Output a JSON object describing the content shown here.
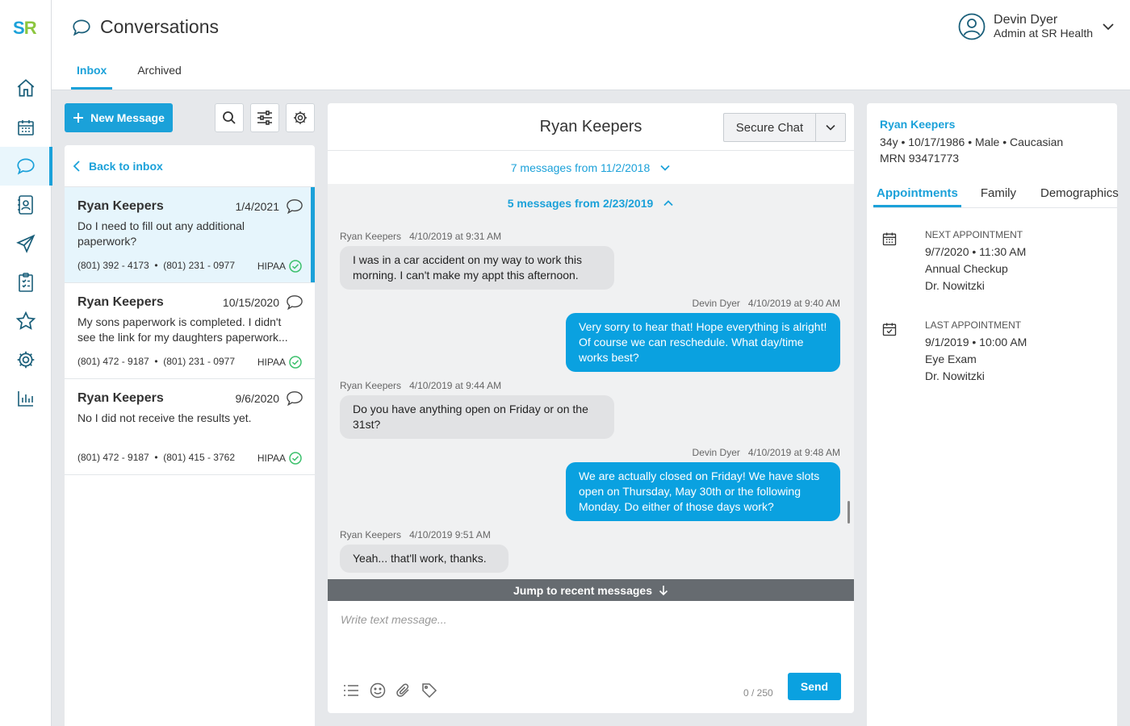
{
  "app": {
    "logo_s": "S",
    "logo_r": "R",
    "title": "Conversations",
    "tabs": [
      {
        "label": "Inbox",
        "active": true
      },
      {
        "label": "Archived",
        "active": false
      }
    ]
  },
  "user": {
    "name": "Devin Dyer",
    "role": "Admin at SR Health"
  },
  "nav": [
    "home-icon",
    "calendar-icon",
    "chat-icon",
    "contacts-icon",
    "send-icon",
    "clipboard-icon",
    "star-icon",
    "gear-icon",
    "chart-icon"
  ],
  "toolbar": {
    "new_message_label": "New Message"
  },
  "inbox": {
    "back_label": "Back to inbox",
    "conversations": [
      {
        "name": "Ryan Keepers",
        "date": "1/4/2021",
        "preview": "Do I need to fill out any additional paperwork?",
        "phones": "(801) 392 - 4173  •  (801) 231 - 0977",
        "badge": "HIPAA",
        "selected": true
      },
      {
        "name": "Ryan Keepers",
        "date": "10/15/2020",
        "preview": "My sons paperwork is completed. I didn't see the link for my daughters paperwork...",
        "phones": "(801) 472 - 9187  •  (801) 231 - 0977",
        "badge": "HIPAA",
        "selected": false
      },
      {
        "name": "Ryan Keepers",
        "date": "9/6/2020",
        "preview": "No I did not receive the results yet.",
        "phones": "(801) 472 - 9187  •  (801) 415 - 3762",
        "badge": "HIPAA",
        "selected": false
      }
    ]
  },
  "chat": {
    "title": "Ryan Keepers",
    "mode_label": "Secure Chat",
    "collapsed_label": "7 messages from 11/2/2018",
    "expanded_label": "5 messages from 2/23/2019",
    "messages": [
      {
        "sender": "Ryan Keepers",
        "time": "4/10/2019 at 9:31 AM",
        "text": "I was in a car accident on my way to work this morning. I can't make my appt this afternoon.",
        "direction": "in"
      },
      {
        "sender": "Devin Dyer",
        "time": "4/10/2019 at 9:40 AM",
        "text": "Very sorry to hear that! Hope everything is alright! Of course we can reschedule. What day/time works best?",
        "direction": "out"
      },
      {
        "sender": "Ryan Keepers",
        "time": "4/10/2019 at 9:44 AM",
        "text": "Do you have anything open on Friday or on the 31st?",
        "direction": "in"
      },
      {
        "sender": "Devin Dyer",
        "time": "4/10/2019 at 9:48 AM",
        "text": "We are actually closed on Friday! We have slots open on Thursday, May 30th or the following Monday. Do either of those days work?",
        "direction": "out"
      },
      {
        "sender": "Ryan Keepers",
        "time": "4/10/2019 9:51 AM",
        "text": "Yeah... that'll work, thanks.",
        "direction": "in"
      }
    ],
    "jump_label": "Jump to recent messages",
    "compose_placeholder": "Write text message...",
    "counter": "0 / 250",
    "send_label": "Send"
  },
  "patient": {
    "name": "Ryan Keepers",
    "details": "34y • 10/17/1986 • Male • Caucasian",
    "mrn": "MRN 93471773",
    "tabs": [
      {
        "label": "Appointments",
        "active": true
      },
      {
        "label": "Family",
        "active": false
      },
      {
        "label": "Demographics",
        "active": false
      }
    ],
    "next": {
      "label": "NEXT APPOINTMENT",
      "datetime": "9/7/2020 • 11:30 AM",
      "type": "Annual Checkup",
      "doctor": "Dr. Nowitzki"
    },
    "last": {
      "label": "LAST APPOINTMENT",
      "datetime": "9/1/2019 • 10:00 AM",
      "type": "Eye Exam",
      "doctor": "Dr. Nowitzki"
    }
  },
  "colors": {
    "accent": "#1ba1d9",
    "logo_green": "#8cc63f",
    "outgoing_bubble": "#0aa1e0",
    "hipaa_ok": "#3cc06c"
  }
}
